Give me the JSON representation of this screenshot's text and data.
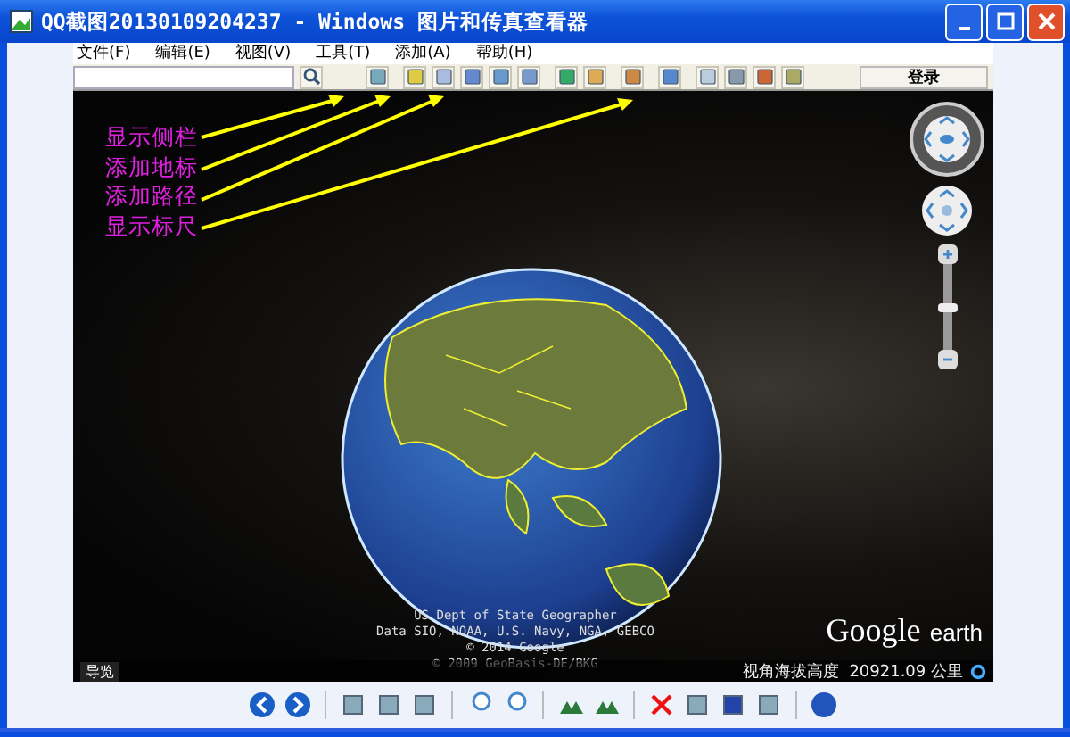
{
  "window": {
    "title": "QQ截图20130109204237 - Windows 图片和传真查看器"
  },
  "menu": [
    "文件(F)",
    "编辑(E)",
    "视图(V)",
    "工具(T)",
    "添加(A)",
    "帮助(H)"
  ],
  "toolbar": {
    "login": "登录"
  },
  "annotations": [
    "显示侧栏",
    "添加地标",
    "添加路径",
    "显示标尺"
  ],
  "attribution": [
    "US Dept of State Geographer",
    "Data SIO, NOAA, U.S. Navy, NGA, GEBCO",
    "© 2014 Google",
    "© 2009 GeoBasis-DE/BKG"
  ],
  "logo": {
    "brand": "Google",
    "product": "earth"
  },
  "status": {
    "tour": "导览",
    "altitude": "视角海拔高度  20921.09 公里"
  },
  "zoom": {
    "level": 0.5
  }
}
